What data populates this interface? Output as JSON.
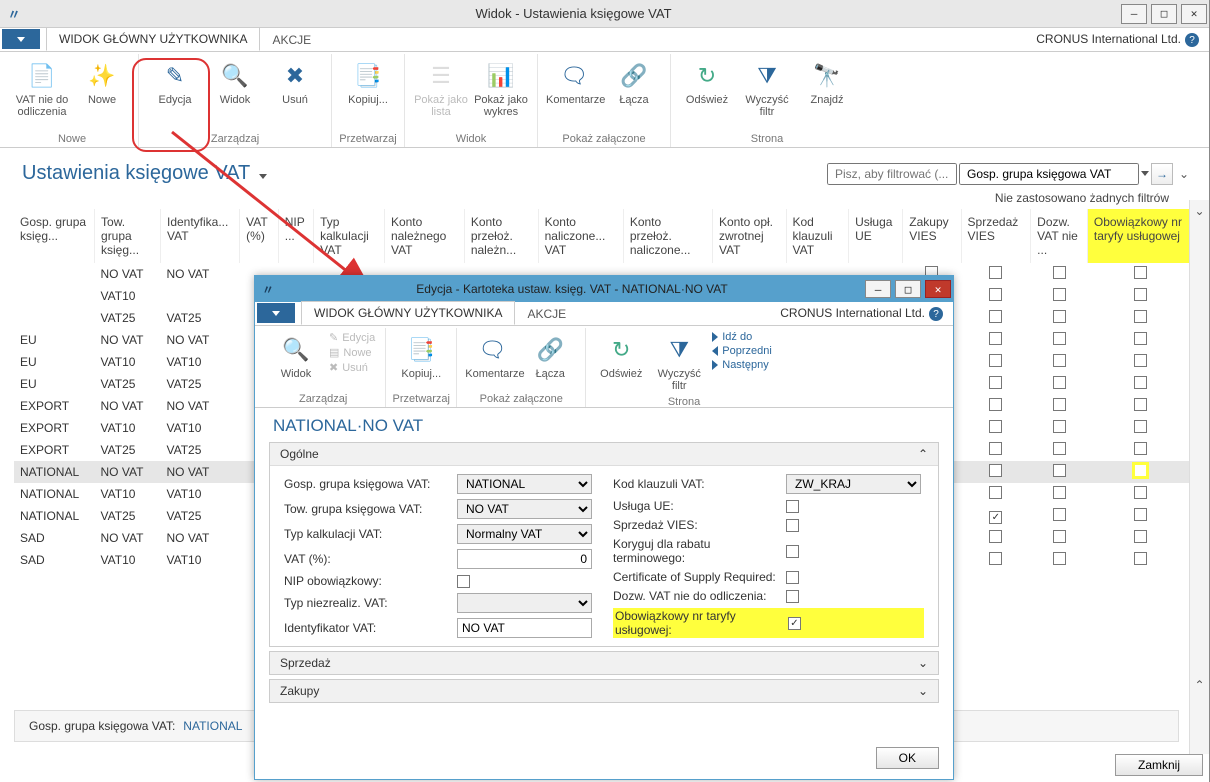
{
  "window": {
    "title": "Widok - Ustawienia księgowe VAT",
    "tenant": "CRONUS International Ltd."
  },
  "tabs": {
    "main": "WIDOK GŁÓWNY UŻYTKOWNIKA",
    "actions": "AKCJE"
  },
  "ribbon": {
    "new_group": "Nowe",
    "manage_group": "Zarządzaj",
    "process_group": "Przetwarzaj",
    "view_group": "Widok",
    "attach_group": "Pokaż załączone",
    "page_group": "Strona",
    "btn_vat_nondeduct": "VAT nie do odliczenia",
    "btn_new": "Nowe",
    "btn_edit": "Edycja",
    "btn_view": "Widok",
    "btn_delete": "Usuń",
    "btn_copy": "Kopiuj...",
    "btn_show_list": "Pokaż jako lista",
    "btn_show_chart": "Pokaż jako wykres",
    "btn_comments": "Komentarze",
    "btn_links": "Łącza",
    "btn_refresh": "Odśwież",
    "btn_clear_filter": "Wyczyść filtr",
    "btn_find": "Znajdź"
  },
  "page": {
    "title": "Ustawienia księgowe VAT",
    "filter_placeholder": "Pisz, aby filtrować (...",
    "filter_field": "Gosp. grupa księgowa VAT",
    "no_filters": "Nie zastosowano żadnych filtrów"
  },
  "columns": [
    {
      "k": "gosp",
      "l": "Gosp. grupa księg..."
    },
    {
      "k": "tow",
      "l": "Tow. grupa księg..."
    },
    {
      "k": "ident",
      "l": "Identyfika... VAT"
    },
    {
      "k": "proc",
      "l": "VAT (%)"
    },
    {
      "k": "nip",
      "l": "NIP ..."
    },
    {
      "k": "typ",
      "l": "Typ kalkulacji VAT"
    },
    {
      "k": "knv",
      "l": "Konto należnego VAT"
    },
    {
      "k": "kpn",
      "l": "Konto przełoż. należn..."
    },
    {
      "k": "knal",
      "l": "Konto naliczone... VAT"
    },
    {
      "k": "kpnal",
      "l": "Konto przełoż. naliczone..."
    },
    {
      "k": "kopl",
      "l": "Konto opł. zwrotnej VAT"
    },
    {
      "k": "kkl",
      "l": "Kod klauzuli VAT"
    },
    {
      "k": "uue",
      "l": "Usługa UE"
    },
    {
      "k": "zv",
      "l": "Zakupy VIES"
    },
    {
      "k": "sv",
      "l": "Sprzedaż VIES"
    },
    {
      "k": "dvn",
      "l": "Dozw. VAT nie ..."
    },
    {
      "k": "obow",
      "l": "Obowiązkowy nr taryfy usługowej"
    }
  ],
  "rows": [
    {
      "gosp": "",
      "tow": "NO VAT",
      "ident": "NO VAT",
      "zv": false,
      "sv": false,
      "dvn": false,
      "obow": false,
      "hl": false
    },
    {
      "gosp": "",
      "tow": "VAT10",
      "ident": "",
      "zv": false,
      "sv": false,
      "dvn": false,
      "obow": false
    },
    {
      "gosp": "",
      "tow": "VAT25",
      "ident": "VAT25",
      "zv": false,
      "sv": false,
      "dvn": false,
      "obow": false
    },
    {
      "gosp": "EU",
      "tow": "NO VAT",
      "ident": "NO VAT",
      "zv": false,
      "sv": false,
      "dvn": false,
      "obow": false
    },
    {
      "gosp": "EU",
      "tow": "VAT10",
      "ident": "VAT10",
      "zv": true,
      "sv": false,
      "dvn": false,
      "obow": false
    },
    {
      "gosp": "EU",
      "tow": "VAT25",
      "ident": "VAT25",
      "zv": true,
      "sv": false,
      "dvn": false,
      "obow": false
    },
    {
      "gosp": "EXPORT",
      "tow": "NO VAT",
      "ident": "NO VAT",
      "zv": false,
      "sv": false,
      "dvn": false,
      "obow": false
    },
    {
      "gosp": "EXPORT",
      "tow": "VAT10",
      "ident": "VAT10",
      "zv": false,
      "sv": false,
      "dvn": false,
      "obow": false
    },
    {
      "gosp": "EXPORT",
      "tow": "VAT25",
      "ident": "VAT25",
      "zv": false,
      "sv": false,
      "dvn": false,
      "obow": false
    },
    {
      "gosp": "NATIONAL",
      "tow": "NO VAT",
      "ident": "NO VAT",
      "zv": false,
      "sv": false,
      "dvn": false,
      "obow": false,
      "sel": true,
      "hl": true
    },
    {
      "gosp": "NATIONAL",
      "tow": "VAT10",
      "ident": "VAT10",
      "zv": false,
      "sv": false,
      "dvn": false,
      "obow": false
    },
    {
      "gosp": "NATIONAL",
      "tow": "VAT25",
      "ident": "VAT25",
      "zv": false,
      "sv": true,
      "dvn": false,
      "obow": false
    },
    {
      "gosp": "SAD",
      "tow": "NO VAT",
      "ident": "NO VAT",
      "zv": false,
      "sv": false,
      "dvn": false,
      "obow": false
    },
    {
      "gosp": "SAD",
      "tow": "VAT10",
      "ident": "VAT10",
      "zv": false,
      "sv": false,
      "dvn": false,
      "obow": false
    }
  ],
  "details": {
    "label": "Gosp. grupa księgowa VAT:",
    "value": "NATIONAL"
  },
  "close_btn": "Zamknij",
  "modal": {
    "title": "Edycja - Kartoteka ustaw. księg. VAT - NATIONAL·NO VAT",
    "tenant": "CRONUS International Ltd.",
    "card_title": "NATIONAL·NO VAT",
    "tabs": {
      "main": "WIDOK GŁÓWNY UŻYTKOWNIKA",
      "actions": "AKCJE"
    },
    "ribbon": {
      "btn_view": "Widok",
      "edit": "Edycja",
      "new": "Nowe",
      "delete": "Usuń",
      "copy": "Kopiuj...",
      "comments": "Komentarze",
      "links": "Łącza",
      "refresh": "Odśwież",
      "clear_filter": "Wyczyść filtr",
      "goto": "Idź do",
      "prev": "Poprzedni",
      "next": "Następny",
      "g_manage": "Zarządzaj",
      "g_process": "Przetwarzaj",
      "g_attach": "Pokaż załączone",
      "g_page": "Strona"
    },
    "general": "Ogólne",
    "fields": {
      "gosp_l": "Gosp. grupa księgowa VAT:",
      "gosp_v": "NATIONAL",
      "tow_l": "Tow. grupa księgowa VAT:",
      "tow_v": "NO VAT",
      "typ_l": "Typ kalkulacji VAT:",
      "typ_v": "Normalny VAT",
      "proc_l": "VAT (%):",
      "proc_v": "0",
      "nip_l": "NIP obowiązkowy:",
      "nip_v": false,
      "tnr_l": "Typ niezrealiz. VAT:",
      "tnr_v": "",
      "ident_l": "Identyfikator VAT:",
      "ident_v": "NO VAT",
      "kkl_l": "Kod klauzuli VAT:",
      "kkl_v": "ZW_KRAJ",
      "uue_l": "Usługa UE:",
      "uue_v": false,
      "sv_l": "Sprzedaż VIES:",
      "sv_v": false,
      "krt_l": "Koryguj dla rabatu terminowego:",
      "krt_v": false,
      "cos_l": "Certificate of Supply Required:",
      "cos_v": false,
      "dvn_l": "Dozw. VAT nie do odliczenia:",
      "dvn_v": false,
      "obow_l": "Obowiązkowy nr taryfy usługowej:",
      "obow_v": true
    },
    "section_sales": "Sprzedaż",
    "section_purchase": "Zakupy",
    "ok": "OK"
  }
}
